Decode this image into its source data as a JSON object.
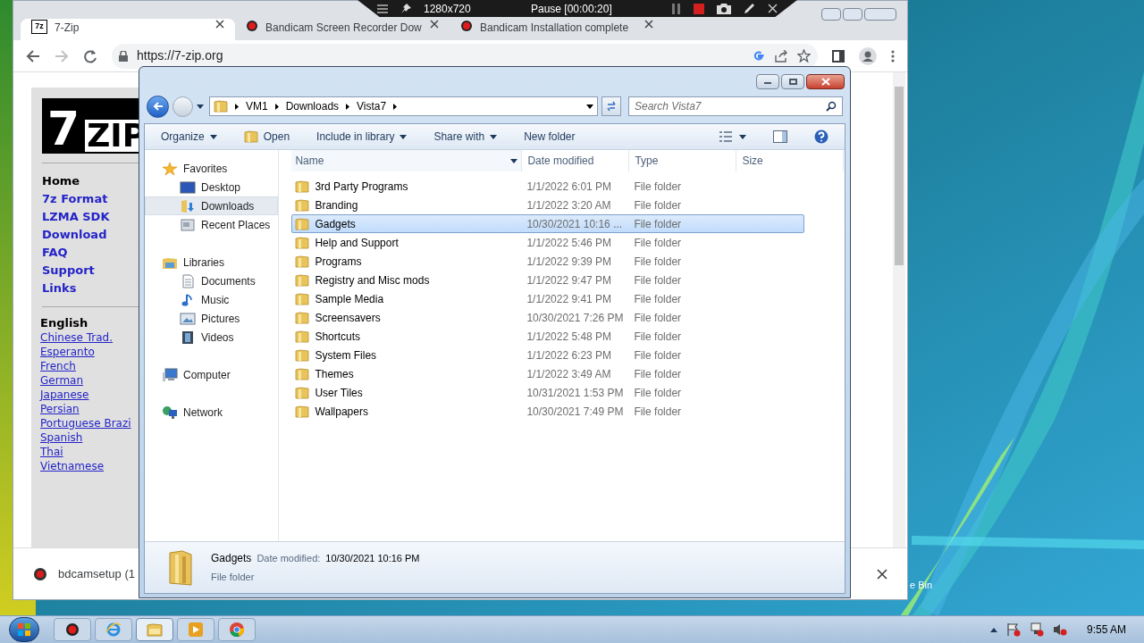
{
  "bandicam": {
    "resolution": "1280x720",
    "status": "Pause [00:00:20]"
  },
  "browser": {
    "tabs": [
      {
        "title": "7-Zip",
        "selected": true,
        "favicon": "7z"
      },
      {
        "title": "Bandicam Screen Recorder Dow",
        "selected": false
      },
      {
        "title": "Bandicam Installation complete",
        "selected": false
      }
    ],
    "url": "https://7-zip.org",
    "site": {
      "logo": [
        "7",
        "ZIP"
      ],
      "nav": [
        {
          "label": "Home",
          "selected": true
        },
        {
          "label": "7z Format",
          "selected": false
        },
        {
          "label": "LZMA SDK",
          "selected": false
        },
        {
          "label": "Download",
          "selected": false
        },
        {
          "label": "FAQ",
          "selected": false
        },
        {
          "label": "Support",
          "selected": false
        },
        {
          "label": "Links",
          "selected": false
        }
      ],
      "languages": [
        {
          "label": "English",
          "selected": true
        },
        {
          "label": "Chinese Trad.",
          "selected": false
        },
        {
          "label": "Esperanto",
          "selected": false
        },
        {
          "label": "French",
          "selected": false
        },
        {
          "label": "German",
          "selected": false
        },
        {
          "label": "Japanese",
          "selected": false
        },
        {
          "label": "Persian",
          "selected": false
        },
        {
          "label": "Portuguese Brazi",
          "selected": false
        },
        {
          "label": "Spanish",
          "selected": false
        },
        {
          "label": "Thai",
          "selected": false
        },
        {
          "label": "Vietnamese",
          "selected": false
        }
      ]
    },
    "download": {
      "file": "bdcamsetup (1"
    }
  },
  "explorer": {
    "breadcrumb": [
      "VM1",
      "Downloads",
      "Vista7"
    ],
    "search_placeholder": "Search Vista7",
    "toolbar": [
      {
        "label": "Organize",
        "kind": "menu"
      },
      {
        "label": "Open",
        "kind": "open"
      },
      {
        "label": "Include in library",
        "kind": "menu"
      },
      {
        "label": "Share with",
        "kind": "menu"
      },
      {
        "label": "New folder",
        "kind": "plain"
      }
    ],
    "nav": [
      {
        "label": "Favorites",
        "kind": "star",
        "selected": false,
        "children": [
          {
            "label": "Desktop",
            "kind": "desktop",
            "selected": false
          },
          {
            "label": "Downloads",
            "kind": "downloads",
            "selected": true
          },
          {
            "label": "Recent Places",
            "kind": "recent",
            "selected": false
          }
        ]
      },
      {
        "label": "Libraries",
        "kind": "library",
        "selected": false,
        "children": [
          {
            "label": "Documents",
            "kind": "documents",
            "selected": false
          },
          {
            "label": "Music",
            "kind": "music",
            "selected": false
          },
          {
            "label": "Pictures",
            "kind": "pictures",
            "selected": false
          },
          {
            "label": "Videos",
            "kind": "videos",
            "selected": false
          }
        ]
      },
      {
        "label": "Computer",
        "kind": "computer",
        "selected": false
      },
      {
        "label": "Network",
        "kind": "network",
        "selected": false
      }
    ],
    "columns": [
      "Name",
      "Date modified",
      "Type",
      "Size"
    ],
    "rows": [
      {
        "name": "3rd Party Programs",
        "date": "1/1/2022 6:01 PM",
        "type": "File folder",
        "selected": false
      },
      {
        "name": "Branding",
        "date": "1/1/2022 3:20 AM",
        "type": "File folder",
        "selected": false
      },
      {
        "name": "Gadgets",
        "date": "10/30/2021 10:16 ...",
        "type": "File folder",
        "selected": true
      },
      {
        "name": "Help and Support",
        "date": "1/1/2022 5:46 PM",
        "type": "File folder",
        "selected": false
      },
      {
        "name": "Programs",
        "date": "1/1/2022 9:39 PM",
        "type": "File folder",
        "selected": false
      },
      {
        "name": "Registry and Misc mods",
        "date": "1/1/2022 9:47 PM",
        "type": "File folder",
        "selected": false
      },
      {
        "name": "Sample Media",
        "date": "1/1/2022 9:41 PM",
        "type": "File folder",
        "selected": false
      },
      {
        "name": "Screensavers",
        "date": "10/30/2021 7:26 PM",
        "type": "File folder",
        "selected": false
      },
      {
        "name": "Shortcuts",
        "date": "1/1/2022 5:48 PM",
        "type": "File folder",
        "selected": false
      },
      {
        "name": "System Files",
        "date": "1/1/2022 6:23 PM",
        "type": "File folder",
        "selected": false
      },
      {
        "name": "Themes",
        "date": "1/1/2022 3:49 AM",
        "type": "File folder",
        "selected": false
      },
      {
        "name": "User Tiles",
        "date": "10/31/2021 1:53 PM",
        "type": "File folder",
        "selected": false
      },
      {
        "name": "Wallpapers",
        "date": "10/30/2021 7:49 PM",
        "type": "File folder",
        "selected": false
      }
    ],
    "details": {
      "name": "Gadgets",
      "label": "Date modified:",
      "value": "10/30/2021 10:16 PM",
      "type": "File folder"
    }
  },
  "desktop": {
    "recycle_bin": "e Bin"
  },
  "taskbar": {
    "apps": [
      {
        "kind": "record",
        "selected": false
      },
      {
        "kind": "ie",
        "selected": false
      },
      {
        "kind": "folder",
        "selected": true
      },
      {
        "kind": "media",
        "selected": false
      },
      {
        "kind": "chrome",
        "selected": false
      }
    ],
    "clock": "9:55 AM"
  }
}
